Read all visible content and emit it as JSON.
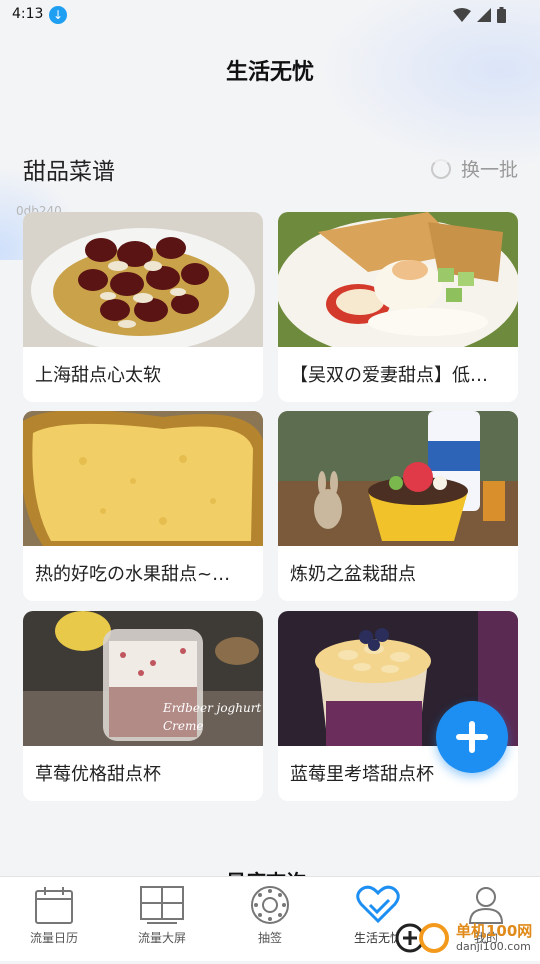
{
  "status_bar": {
    "time": "4:13"
  },
  "app": {
    "title": "生活无忧"
  },
  "section": {
    "title": "甜品菜谱",
    "refresh_label": "换一批",
    "debug_id": "0db240"
  },
  "cards": [
    {
      "title": "上海甜点心太软",
      "image": "red-dates-dessert"
    },
    {
      "title": "【吴双の爱妻甜点】低…",
      "image": "pancake-dessert-plate"
    },
    {
      "title": "热的好吃の水果甜点~…",
      "image": "fruit-tart"
    },
    {
      "title": "炼奶之盆栽甜点",
      "image": "potted-dessert"
    },
    {
      "title": "草莓优格甜点杯",
      "image": "strawberry-yogurt-cup"
    },
    {
      "title": "蓝莓里考塔甜点杯",
      "image": "blueberry-ricotta-cup"
    }
  ],
  "image_texts": {
    "yogurt_caption_1": "Erdbeer joghurt",
    "yogurt_caption_2": "Creme"
  },
  "next_section": {
    "title": "星座查询"
  },
  "tabs": [
    {
      "label": "流量日历",
      "icon": "calendar-icon"
    },
    {
      "label": "流量大屏",
      "icon": "grid-screen-icon"
    },
    {
      "label": "抽签",
      "icon": "dial-icon"
    },
    {
      "label": "生活无忧",
      "icon": "heart-check-icon",
      "active": true
    },
    {
      "label": "我的",
      "icon": "user-icon"
    }
  ],
  "watermark": {
    "text": "单机100网",
    "url": "danji100.com"
  },
  "colors": {
    "accent": "#1e8ff2",
    "background": "#f3f4f6"
  }
}
